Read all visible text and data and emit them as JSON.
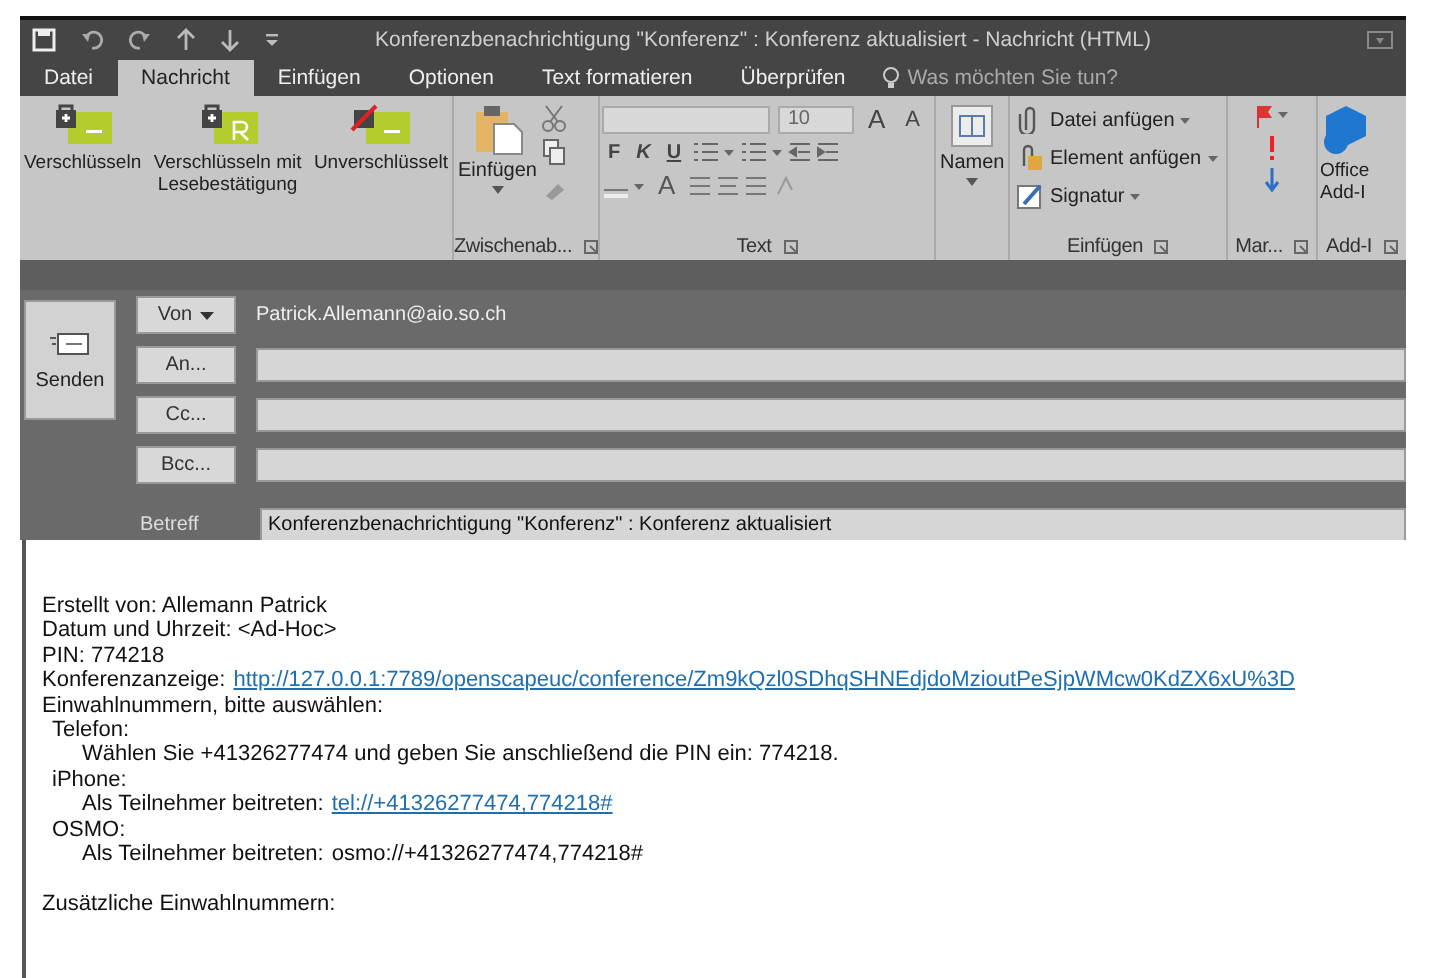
{
  "window": {
    "title": "Konferenzbenachrichtigung \"Konferenz\" : Konferenz aktualisiert - Nachricht (HTML)"
  },
  "tabs": [
    {
      "label": "Datei",
      "selected": false
    },
    {
      "label": "Nachricht",
      "selected": true
    },
    {
      "label": "Einfügen",
      "selected": false
    },
    {
      "label": "Optionen",
      "selected": false
    },
    {
      "label": "Text formatieren",
      "selected": false
    },
    {
      "label": "Überprüfen",
      "selected": false
    }
  ],
  "search": {
    "placeholder": "Was möchten Sie tun?"
  },
  "ribbon": {
    "encryption": [
      {
        "label": "Verschlüsseln",
        "kind": "lock"
      },
      {
        "label": "Verschlüsseln mit Lesebestätigung",
        "kind": "receipt"
      },
      {
        "label": "Unverschlüsselt",
        "kind": "unlocked"
      }
    ],
    "clipboard": {
      "paste": "Einfügen",
      "group": "Zwischenab..."
    },
    "text": {
      "font_size": "10",
      "size_buttons": [
        "A",
        "A"
      ],
      "format_buttons": [
        "F",
        "K",
        "U"
      ],
      "color_button": "A",
      "group": "Text"
    },
    "names": {
      "label": "Namen"
    },
    "insert": {
      "items": [
        {
          "label": "Datei anfügen",
          "kind": "attach"
        },
        {
          "label": "Element anfügen",
          "kind": "item"
        },
        {
          "label": "Signatur",
          "kind": "signature"
        }
      ],
      "group": "Einfügen"
    },
    "tags": {
      "group": "Mar..."
    },
    "addins": {
      "label": [
        "Office",
        "Add-I"
      ],
      "group": "Add-I"
    }
  },
  "header": {
    "send": "Senden",
    "from": {
      "button": "Von",
      "value": "Patrick.Allemann@aio.so.ch"
    },
    "recipients": [
      {
        "button": "An..."
      },
      {
        "button": "Cc..."
      },
      {
        "button": "Bcc..."
      }
    ],
    "subject": {
      "label": "Betreff",
      "value": "Konferenzbenachrichtigung \"Konferenz\" : Konferenz aktualisiert"
    }
  },
  "body": {
    "fields": [
      {
        "text": "Erstellt von: Allemann Patrick"
      },
      {
        "text": "Datum und Uhrzeit: <Ad-Hoc>"
      },
      {
        "text": "PIN: 774218"
      },
      {
        "label": "Konferenzanzeige:",
        "link": "http://127.0.0.1:7789/openscapeuc/conference/Zm9kQzl0SDhqSHNEdjdoMzioutPeSjpWMcw0KdZX6xU%3D"
      }
    ],
    "dial_in": {
      "heading": "Einwahlnummern, bitte auswählen:",
      "children": [
        {
          "name": "Telefon:",
          "children": [
            {
              "text": "Wählen Sie +41326277474 und geben Sie anschließend die PIN ein: 774218."
            }
          ]
        },
        {
          "name": "iPhone:",
          "children": [
            {
              "label": "Als Teilnehmer beitreten:",
              "link": "tel://+41326277474,774218#"
            }
          ]
        },
        {
          "name": "OSMO:",
          "children": [
            {
              "label": "Als Teilnehmer beitreten:",
              "text": "osmo://+41326277474,774218#"
            }
          ]
        }
      ]
    },
    "footer": "Zusätzliche Einwahlnummern:"
  }
}
